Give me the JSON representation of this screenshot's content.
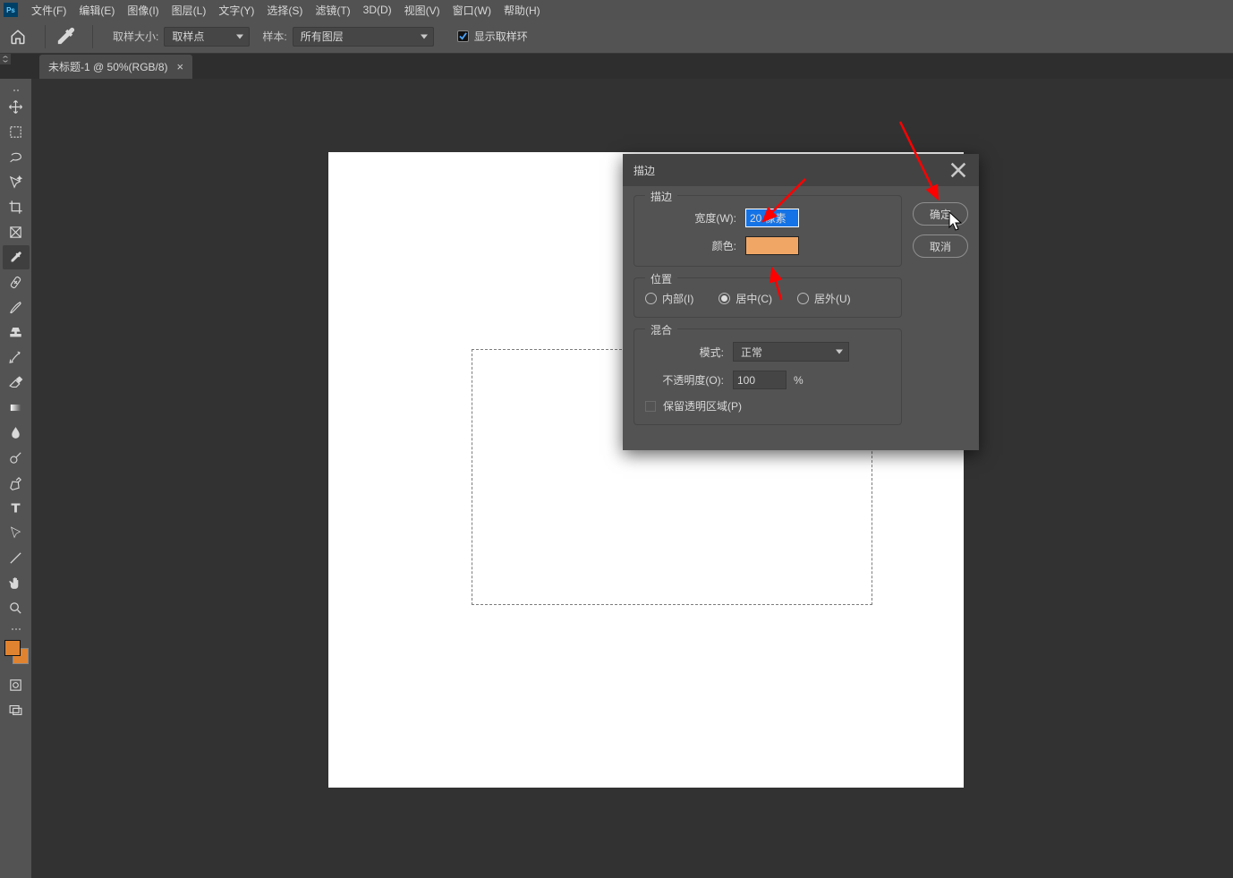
{
  "menu": [
    "文件(F)",
    "编辑(E)",
    "图像(I)",
    "图层(L)",
    "文字(Y)",
    "选择(S)",
    "滤镜(T)",
    "3D(D)",
    "视图(V)",
    "窗口(W)",
    "帮助(H)"
  ],
  "options": {
    "sample_size_label": "取样大小:",
    "sample_size_value": "取样点",
    "sample_label": "样本:",
    "sample_value": "所有图层",
    "show_ring": "显示取样环"
  },
  "tab": {
    "label": "未标题-1 @ 50%(RGB/8)",
    "close": "×"
  },
  "dialog": {
    "title": "描边",
    "ok": "确定",
    "cancel": "取消",
    "group_stroke": "描边",
    "width_label": "宽度(W):",
    "width_value": "20 像素",
    "color_label": "颜色:",
    "color_hex": "#f0a766",
    "group_position": "位置",
    "pos_inside": "内部(I)",
    "pos_center": "居中(C)",
    "pos_outside": "居外(U)",
    "group_blend": "混合",
    "mode_label": "模式:",
    "mode_value": "正常",
    "opacity_label": "不透明度(O):",
    "opacity_value": "100",
    "opacity_suffix": "%",
    "preserve": "保留透明区域(P)"
  }
}
